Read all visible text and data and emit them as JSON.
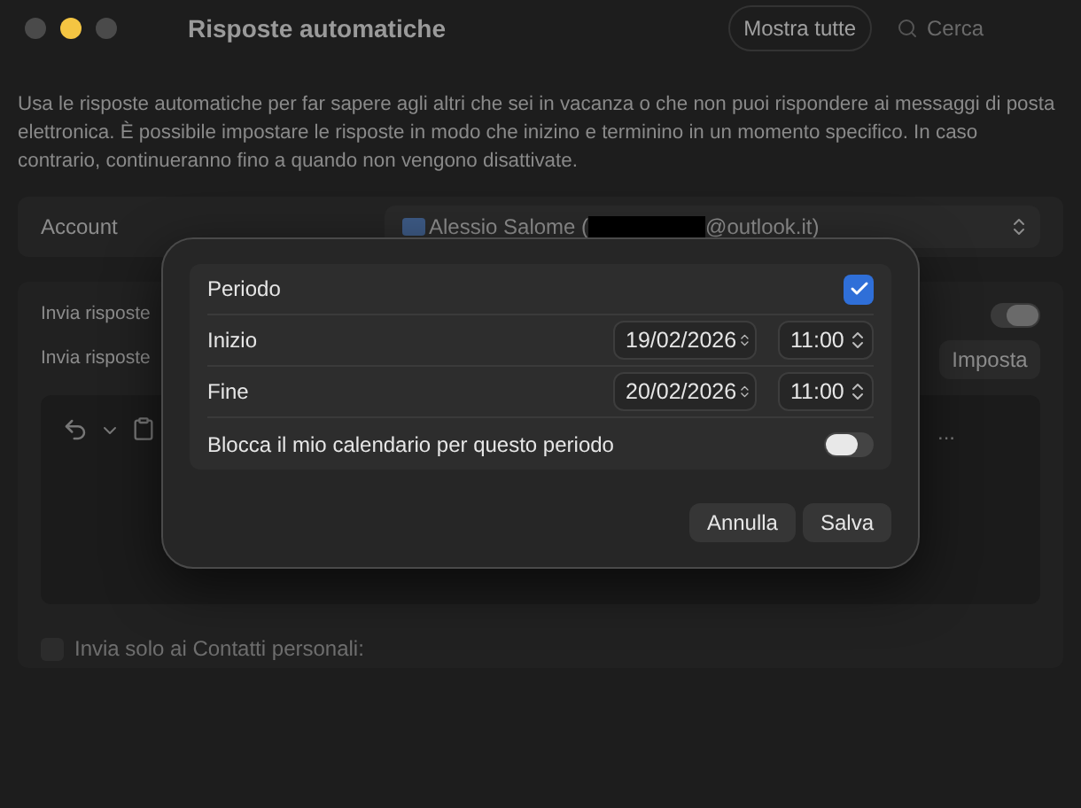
{
  "window": {
    "title": "Risposte automatiche"
  },
  "toolbar": {
    "show_all": "Mostra tutte",
    "search": {
      "placeholder": "Cerca"
    }
  },
  "description": "Usa le risposte automatiche per far sapere agli altri che sei in vacanza o che non puoi rispondere ai messaggi di posta elettronica. È possibile impostare le risposte in modo che inizino e terminino in un momento specifico. In caso contrario, continueranno fino a quando non vengono disattivate.",
  "account": {
    "label": "Account",
    "name": "Alessio Salome (",
    "suffix": "@outlook.it)"
  },
  "auto_reply": {
    "rows": [
      {
        "kind": "toggle",
        "label": "Invia risposte",
        "on": true
      },
      {
        "kind": "button",
        "label": "Invia risposte",
        "button": "Imposta"
      }
    ],
    "editor": {
      "more": "..."
    },
    "contacts_only": {
      "label": "Invia solo ai Contatti personali:",
      "checked": false
    }
  },
  "dialog": {
    "period": {
      "label": "Periodo",
      "checked": true
    },
    "rows": [
      {
        "label": "Inizio",
        "date": "19/02/2026",
        "time": "11:00"
      },
      {
        "label": "Fine",
        "date": "20/02/2026",
        "time": "11:00"
      }
    ],
    "block": {
      "label": "Blocca il mio calendario per questo periodo",
      "on": false
    },
    "buttons": [
      "Annulla",
      "Salva"
    ]
  }
}
